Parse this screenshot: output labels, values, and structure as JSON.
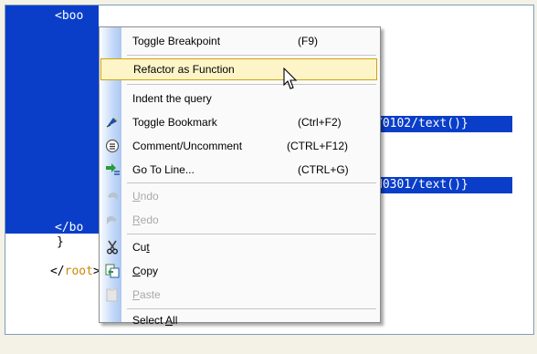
{
  "editor": {
    "lines": {
      "book_open": "<book>",
      "book_open_visible": "<boo",
      "frag1": "Y0102/text()}",
      "frag2": "N0301/text()}",
      "book_close": "</bo",
      "brace": "}",
      "root_lt": "</",
      "root_name": "root",
      "root_gt": ">"
    }
  },
  "menu": {
    "items": [
      {
        "label": "Toggle Breakpoint",
        "shortcut": "(F9)",
        "icon": "none"
      },
      {
        "label": "Refactor as Function",
        "shortcut": "",
        "icon": "none",
        "state": "hover"
      },
      {
        "label": "Indent the query",
        "shortcut": "",
        "icon": "none"
      },
      {
        "label": "Toggle Bookmark",
        "shortcut": "(Ctrl+F2)",
        "icon": "bookmark-icon"
      },
      {
        "label": "Comment/Uncomment",
        "shortcut": "(CTRL+F12)",
        "icon": "comment-icon"
      },
      {
        "label": "Go To Line...",
        "shortcut": "(CTRL+G)",
        "icon": "goto-line-icon"
      },
      {
        "label": "Undo",
        "shortcut": "",
        "icon": "undo-icon",
        "state": "disabled",
        "mnemonic": "U"
      },
      {
        "label": "Redo",
        "shortcut": "",
        "icon": "redo-icon",
        "state": "disabled",
        "mnemonic": "R"
      },
      {
        "label": "Cut",
        "shortcut": "",
        "icon": "scissors-icon",
        "mnemonic": "t"
      },
      {
        "label": "Copy",
        "shortcut": "",
        "icon": "copy-icon",
        "mnemonic": "C"
      },
      {
        "label": "Paste",
        "shortcut": "",
        "icon": "paste-icon",
        "state": "disabled",
        "mnemonic": "P"
      },
      {
        "label": "Select All",
        "shortcut": "",
        "icon": "none",
        "mnemonic": "A"
      }
    ]
  },
  "colors": {
    "selection": "#0a3ec9",
    "menu_hover_bg": "#fdf5c8",
    "menu_hover_border": "#d1a30a",
    "tag_text": "#0000ff",
    "root_text": "#cc8800"
  }
}
